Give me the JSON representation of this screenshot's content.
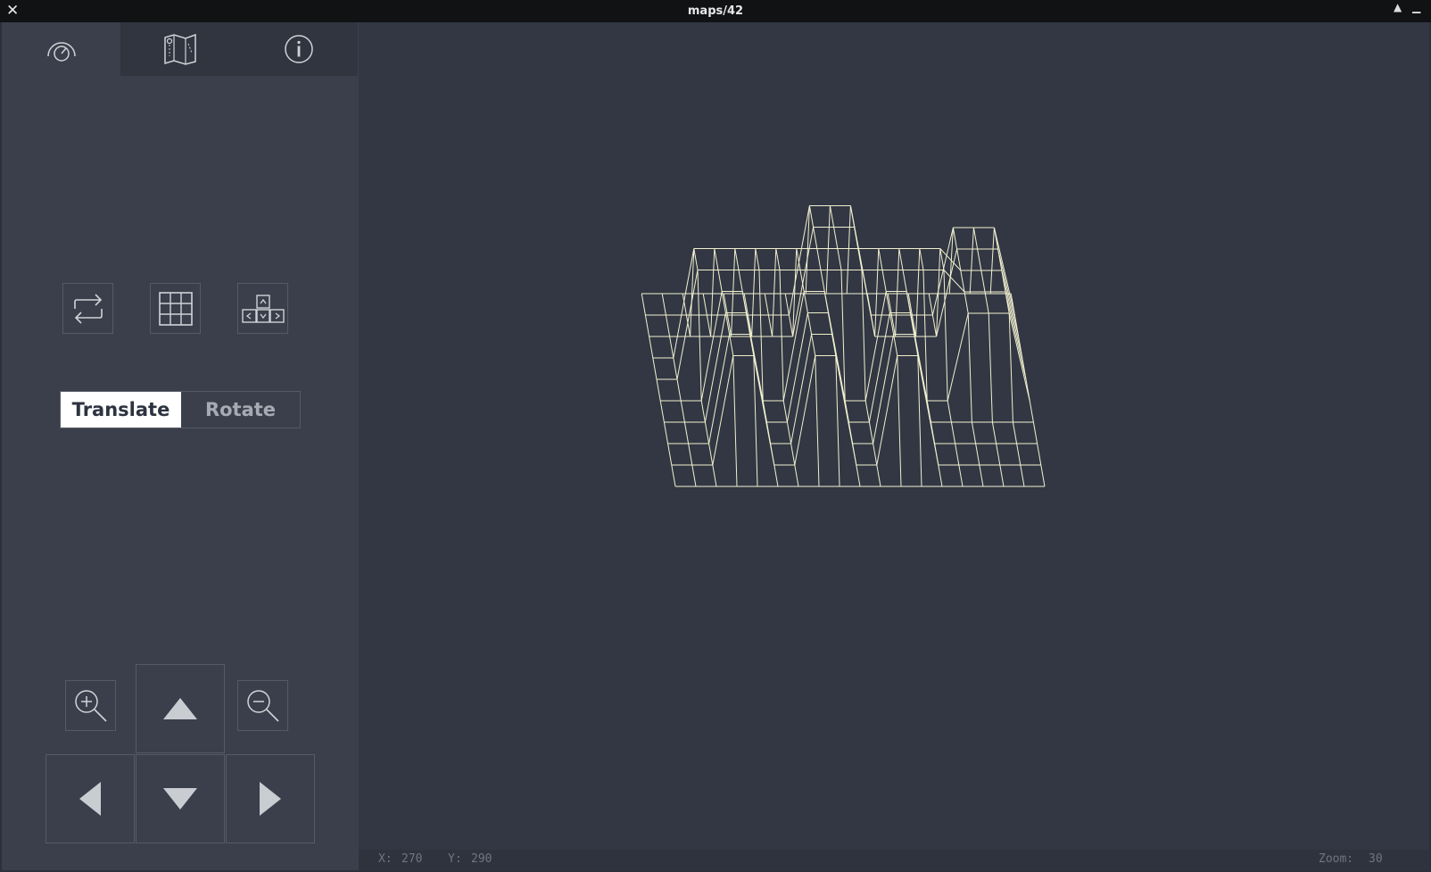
{
  "window": {
    "title": "maps/42",
    "close_glyph": "✕",
    "maximize_glyph": "▲",
    "minimize_glyph": "▁"
  },
  "tabs": [
    {
      "icon": "gauge-icon",
      "active": true
    },
    {
      "icon": "map-icon",
      "active": false
    },
    {
      "icon": "info-icon",
      "active": false
    }
  ],
  "tools": [
    "swap-arrows-icon",
    "grid-icon",
    "arrow-keys-icon"
  ],
  "mode": {
    "translate_label": "Translate",
    "rotate_label": "Rotate",
    "selected": "Translate"
  },
  "navigation": [
    "zoom-in-icon",
    "zoom-out-icon",
    "arrow-up-icon",
    "arrow-down-icon",
    "arrow-left-icon",
    "arrow-right-icon"
  ],
  "status": {
    "x_label": "X:",
    "x_value": "270",
    "y_label": "Y:",
    "y_value": "290",
    "zoom_label": "Zoom:",
    "zoom_value": "30"
  },
  "colors": {
    "background": "#323743",
    "sidebar": "#3a3f4b",
    "wireframe": "#f1f0cf",
    "icon": "#d0d3d8"
  }
}
